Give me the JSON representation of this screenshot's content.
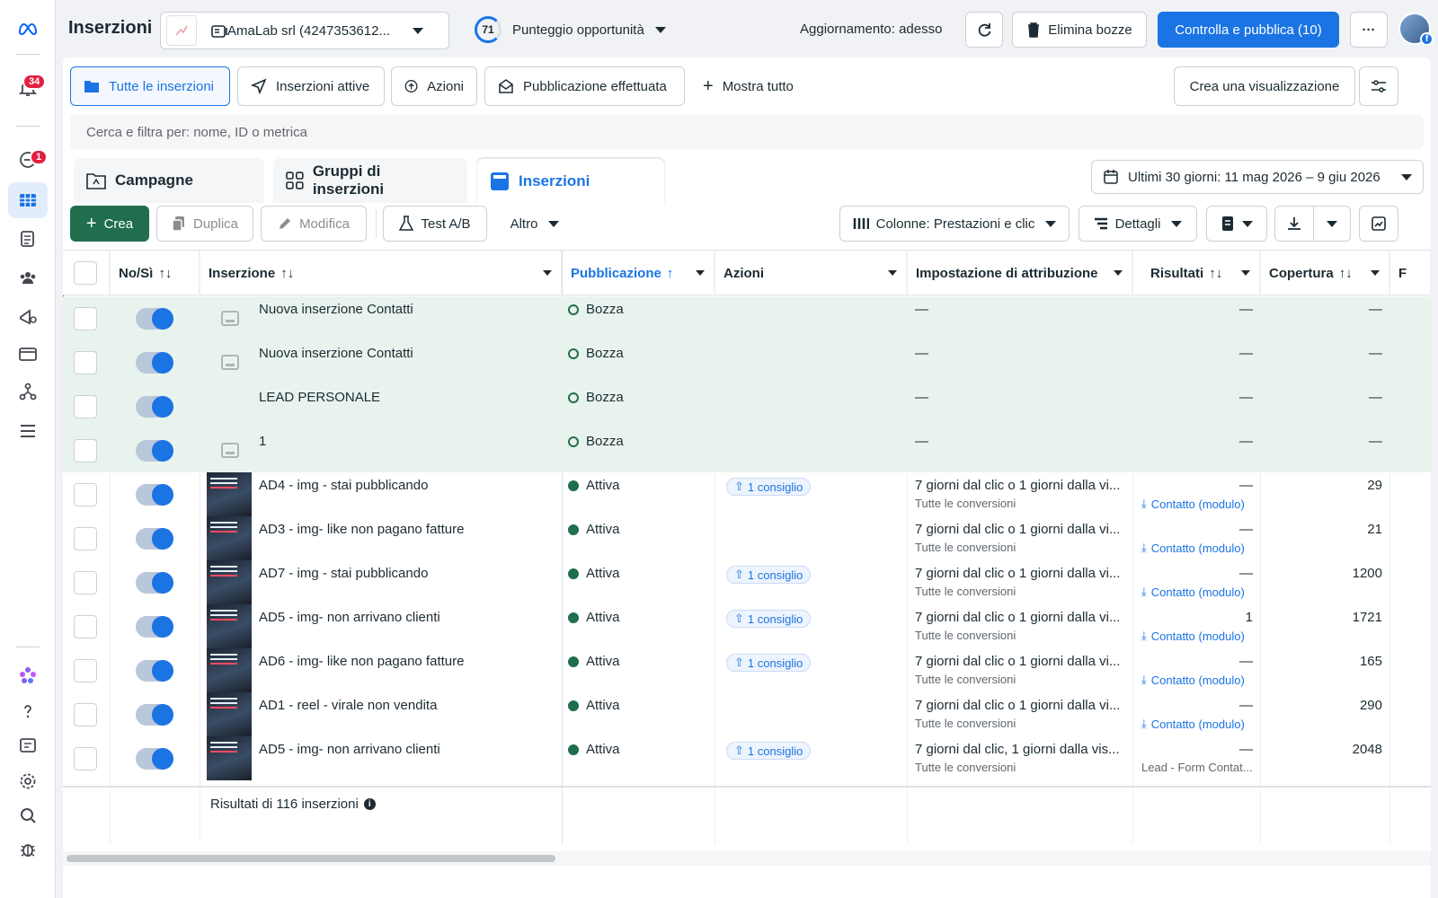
{
  "app": {
    "title": "Inserzioni",
    "notifications_count": "34",
    "alerts_count": "1"
  },
  "topbar": {
    "account_name": "AmaLab srl (4247353612...",
    "opportunity_score": "71",
    "opportunity_label": "Punteggio opportunità",
    "update_status": "Aggiornamento: adesso",
    "delete_drafts": "Elimina bozze",
    "review_publish": "Controlla e pubblica (10)",
    "more": "···"
  },
  "views": {
    "all_ads": "Tutte le inserzioni",
    "active_ads": "Inserzioni attive",
    "actions": "Azioni",
    "published": "Pubblicazione effettuata",
    "show_all": "Mostra tutto",
    "create_view": "Crea una visualizzazione"
  },
  "search": {
    "placeholder": "Cerca e filtra per: nome, ID o metrica"
  },
  "levels": {
    "campaigns": "Campagne",
    "ad_sets": "Gruppi di inserzioni",
    "ads": "Inserzioni"
  },
  "date_range": "Ultimi 30 giorni: 11 mag 2026 – 9 giu 2026",
  "toolbar": {
    "create": "Crea",
    "duplicate": "Duplica",
    "edit": "Modifica",
    "ab_test": "Test A/B",
    "more": "Altro",
    "columns": "Colonne: Prestazioni e clic",
    "breakdown": "Dettagli"
  },
  "table": {
    "headers": {
      "onoff": "No/Sì",
      "ad": "Inserzione",
      "delivery": "Pubblicazione",
      "actions": "Azioni",
      "attribution": "Impostazione di attribuzione",
      "results": "Risultati",
      "reach": "Copertura",
      "next": "F"
    },
    "drafts": [
      {
        "name": "Nuova inserzione Contatti",
        "status": "Bozza",
        "attribution": "—",
        "results": "—",
        "reach": "—"
      },
      {
        "name": "Nuova inserzione Contatti",
        "status": "Bozza",
        "attribution": "—",
        "results": "—",
        "reach": "—"
      },
      {
        "name": "LEAD PERSONALE",
        "status": "Bozza",
        "attribution": "—",
        "results": "—",
        "reach": "—"
      },
      {
        "name": "1",
        "status": "Bozza",
        "attribution": "—",
        "results": "—",
        "reach": "—"
      }
    ],
    "rows": [
      {
        "name": "AD4 - img - stai pubblicando",
        "status": "Attiva",
        "tip": "1 consiglio",
        "attribution": "7 giorni dal clic o 1 giorni dalla vi...",
        "conv": "Tutte le conversioni",
        "results": "—",
        "result_type": "Contatto (modulo)",
        "reach": "29"
      },
      {
        "name": "AD3 - img- like non pagano fatture",
        "status": "Attiva",
        "tip": "",
        "attribution": "7 giorni dal clic o 1 giorni dalla vi...",
        "conv": "Tutte le conversioni",
        "results": "—",
        "result_type": "Contatto (modulo)",
        "reach": "21"
      },
      {
        "name": "AD7 - img - stai pubblicando",
        "status": "Attiva",
        "tip": "1 consiglio",
        "attribution": "7 giorni dal clic o 1 giorni dalla vi...",
        "conv": "Tutte le conversioni",
        "results": "—",
        "result_type": "Contatto (modulo)",
        "reach": "1200"
      },
      {
        "name": "AD5 - img- non arrivano clienti",
        "status": "Attiva",
        "tip": "1 consiglio",
        "attribution": "7 giorni dal clic o 1 giorni dalla vi...",
        "conv": "Tutte le conversioni",
        "results": "1",
        "result_type": "Contatto (modulo)",
        "reach": "1721"
      },
      {
        "name": "AD6 - img- like non pagano fatture",
        "status": "Attiva",
        "tip": "1 consiglio",
        "attribution": "7 giorni dal clic o 1 giorni dalla vi...",
        "conv": "Tutte le conversioni",
        "results": "—",
        "result_type": "Contatto (modulo)",
        "reach": "165"
      },
      {
        "name": "AD1 - reel - virale non vendita",
        "status": "Attiva",
        "tip": "",
        "attribution": "7 giorni dal clic o 1 giorni dalla vi...",
        "conv": "Tutte le conversioni",
        "results": "—",
        "result_type": "Contatto (modulo)",
        "reach": "290"
      },
      {
        "name": "AD5 - img- non arrivano clienti",
        "status": "Attiva",
        "tip": "1 consiglio",
        "attribution": "7 giorni dal clic, 1 giorni dalla vis...",
        "conv": "Tutte le conversioni",
        "results": "—",
        "result_type": "Lead - Form Contat...",
        "reach": "2048"
      }
    ],
    "footer": "Risultati di 116 inserzioni"
  },
  "colors": {
    "brand_blue": "#1b74e4",
    "create_green": "#216e4e",
    "draft_bg": "#e9f3ee"
  }
}
